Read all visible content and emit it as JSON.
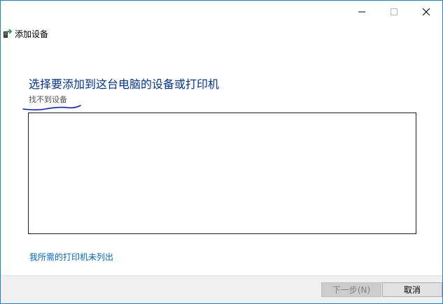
{
  "window": {
    "title": "添加设备"
  },
  "title_bar": {
    "controls": [
      "minimize",
      "maximize",
      "close"
    ]
  },
  "main": {
    "heading": "选择要添加到这台电脑的设备或打印机",
    "status": "找不到设备",
    "device_list": [],
    "link": "我所需的打印机未列出"
  },
  "footer": {
    "next_label": "下一步(N)",
    "cancel_label": "取消"
  },
  "colors": {
    "heading": "#003399",
    "link": "#0066cc",
    "window_border": "#1883d7",
    "scribble": "#0a1fd1"
  }
}
